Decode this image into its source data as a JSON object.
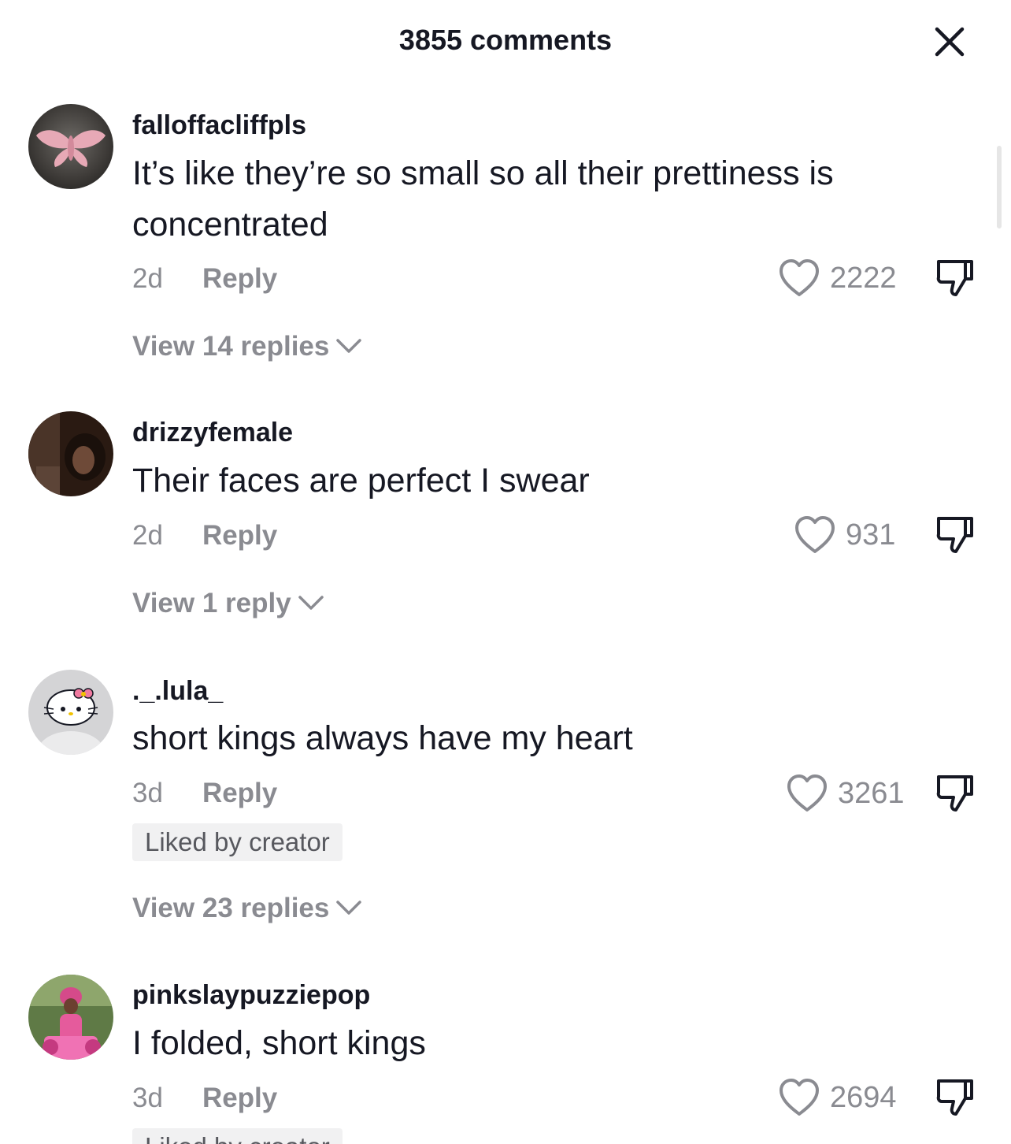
{
  "header": {
    "title": "3855 comments",
    "close_icon": "close-icon"
  },
  "comments": [
    {
      "username": "falloffacliffpls",
      "text": "It’s like they’re so small so all their prettiness is concentrated",
      "time": "2d",
      "reply_label": "Reply",
      "likes": "2222",
      "view_replies": "View 14 replies"
    },
    {
      "username": "drizzyfemale",
      "text": "Their faces are perfect I swear",
      "time": "2d",
      "reply_label": "Reply",
      "likes": "931",
      "view_replies": "View 1 reply"
    },
    {
      "username": "._.lula_",
      "text": "short kings always have my heart",
      "time": "3d",
      "reply_label": "Reply",
      "likes": "3261",
      "badge": "Liked by creator",
      "view_replies": "View 23 replies"
    },
    {
      "username": "pinkslaypuzziepop",
      "text": "I folded, short kings",
      "time": "3d",
      "reply_label": "Reply",
      "likes": "2694",
      "badge": "Liked by creator"
    }
  ],
  "colors": {
    "text_primary": "#161823",
    "text_secondary": "#8a8b91",
    "badge_bg": "#f1f1f2"
  }
}
